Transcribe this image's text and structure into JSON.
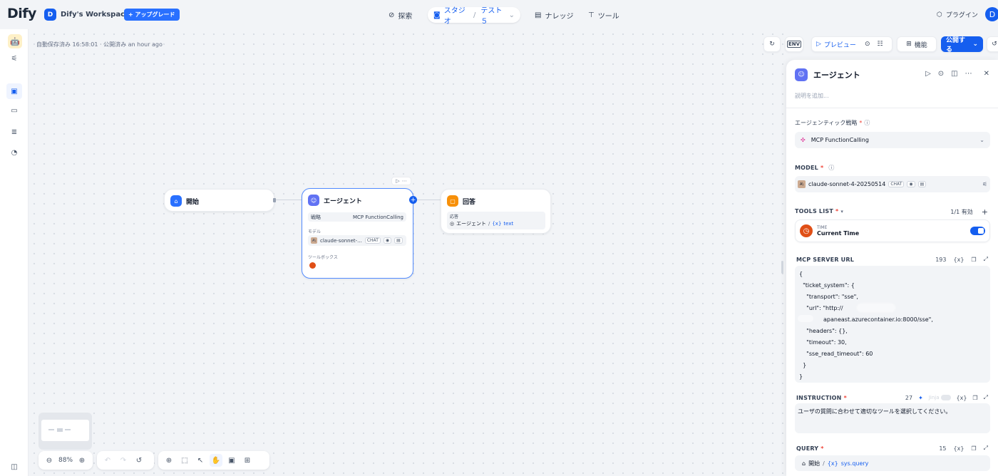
{
  "app": {
    "logo": "Dify",
    "workspace_initial": "D",
    "workspace_name": "Dify's Workspace",
    "upgrade_label": "アップグレード"
  },
  "nav": {
    "explore": "探索",
    "studio": "スタジオ",
    "app_name": "テスト５",
    "knowledge": "ナレッジ",
    "tools": "ツール",
    "plugins": "プラグイン",
    "user_initial": "D"
  },
  "toolbar": {
    "saved_status": "自動保存済み 16:58:01 · 公開済み an hour ago",
    "env_label": "ENV",
    "preview_label": "プレビュー",
    "features_label": "機能",
    "publish_label": "公開する"
  },
  "nodes": {
    "start": {
      "title": "開始"
    },
    "agent": {
      "title": "エージェント",
      "strategy_label": "戦略",
      "strategy_value": "MCP FunctionCalling",
      "model_label": "モデル",
      "model_value": "claude-sonnet-...",
      "model_tag": "CHAT",
      "toolbox_label": "ツールボックス"
    },
    "answer": {
      "title": "回答",
      "response_label": "応答",
      "ref_node": "エージェント",
      "ref_var": "text"
    }
  },
  "zoom": {
    "level": "88%"
  },
  "panel": {
    "title": "エージェント",
    "description_placeholder": "説明を追加...",
    "strategy_label": "エージェンティック戦略",
    "strategy_value": "MCP FunctionCalling",
    "model_label": "MODEL",
    "model_value": "claude-sonnet-4-20250514",
    "model_tag": "CHAT",
    "tools_label": "TOOLS LIST",
    "tools_count": "1/1 有効",
    "tool_provider": "TIME",
    "tool_name": "Current Time",
    "tool_enabled": true,
    "mcp_label": "MCP SERVER URL",
    "mcp_count": "193",
    "mcp_lines": [
      "{",
      "  \"ticket_system\": {",
      "    \"transport\": \"sse\",",
      "    \"url\": \"http://",
      "apaneast.azurecontainer.io:8000/sse\",",
      "    \"headers\": {},",
      "    \"timeout\": 30,",
      "    \"sse_read_timeout\": 60",
      "  }",
      "}"
    ],
    "instruction_label": "INSTRUCTION",
    "instruction_count": "27",
    "jinja_label": "Jinja",
    "instruction_text": "ユーザの質問に合わせて適切なツールを選択してください。",
    "query_label": "QUERY",
    "query_count": "15",
    "query_node": "開始",
    "query_var": "sys.query"
  },
  "colors": {
    "accent": "#155eef",
    "start_icon": "#2970ff",
    "agent_icon": "#6172f3",
    "answer_icon": "#f79009",
    "tool_icon": "#e04f16"
  }
}
